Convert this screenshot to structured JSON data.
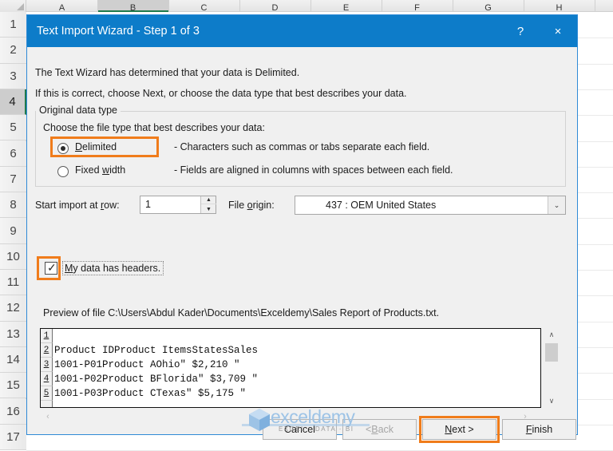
{
  "spreadsheet": {
    "column_letters": [
      "A",
      "B",
      "C",
      "D",
      "E",
      "F",
      "G",
      "H"
    ],
    "row_numbers": [
      "1",
      "2",
      "3",
      "4",
      "5",
      "6",
      "7",
      "8",
      "9",
      "10",
      "11",
      "12",
      "13",
      "14",
      "15",
      "16",
      "17"
    ],
    "selected_row": "4"
  },
  "dialog": {
    "title": "Text Import Wizard - Step 1 of 3",
    "help_icon": "?",
    "close_icon": "×",
    "intro_line1": "The Text Wizard has determined that your data is Delimited.",
    "intro_line2": "If this is correct, choose Next, or choose the data type that best describes your data.",
    "group": {
      "legend": "Original data type",
      "choose_label": "Choose the file type that best describes your data:",
      "options": [
        {
          "label_pre": "",
          "label_key": "D",
          "label_post": "elimited",
          "description": "- Characters such as commas or tabs separate each field.",
          "selected": true
        },
        {
          "label_pre": "Fixed ",
          "label_key": "w",
          "label_post": "idth",
          "description": "- Fields are aligned in columns with spaces between each field.",
          "selected": false
        }
      ]
    },
    "start_import": {
      "label_pre": "Start import at ",
      "label_key": "r",
      "label_post": "ow:",
      "value": "1",
      "spin_up_icon": "▲",
      "spin_down_icon": "▼"
    },
    "file_origin": {
      "label_pre": "File ",
      "label_key": "o",
      "label_post": "rigin:",
      "value": "437 : OEM United States",
      "arrow_icon": "⌄"
    },
    "headers_checkbox": {
      "checked": true,
      "check_glyph": "✓",
      "label_key": "M",
      "label_post": "y data has headers."
    },
    "preview": {
      "label": "Preview of file C:\\Users\\Abdul Kader\\Documents\\Exceldemy\\Sales Report of Products.txt.",
      "lines": [
        {
          "num": "1",
          "text": ""
        },
        {
          "num": "2",
          "text": "Product IDProduct ItemsStatesSales"
        },
        {
          "num": "3",
          "text": "1001-P01Product AOhio\" $2,210 \""
        },
        {
          "num": "4",
          "text": "1001-P02Product BFlorida\" $3,709 \""
        },
        {
          "num": "5",
          "text": "1001-P03Product CTexas\" $5,175 \""
        }
      ],
      "scroll_up_icon": "∧",
      "scroll_down_icon": "∨",
      "scroll_left_icon": "‹",
      "scroll_right_icon": "›"
    },
    "buttons": [
      {
        "name": "cancel",
        "pre": "Cancel",
        "key": "",
        "post": "",
        "disabled": false
      },
      {
        "name": "back",
        "pre": "< ",
        "key": "B",
        "post": "ack",
        "disabled": true
      },
      {
        "name": "next",
        "pre": "",
        "key": "N",
        "post": "ext >",
        "disabled": false
      },
      {
        "name": "finish",
        "pre": "",
        "key": "F",
        "post": "inish",
        "disabled": false
      }
    ]
  },
  "watermark": {
    "brand": "exceldemy",
    "tagline": "EXCEL · DATA · BI"
  },
  "colors": {
    "titlebar": "#0d7cc9",
    "highlight": "#f07c1b",
    "dialog_bg": "#f0f0f0"
  }
}
